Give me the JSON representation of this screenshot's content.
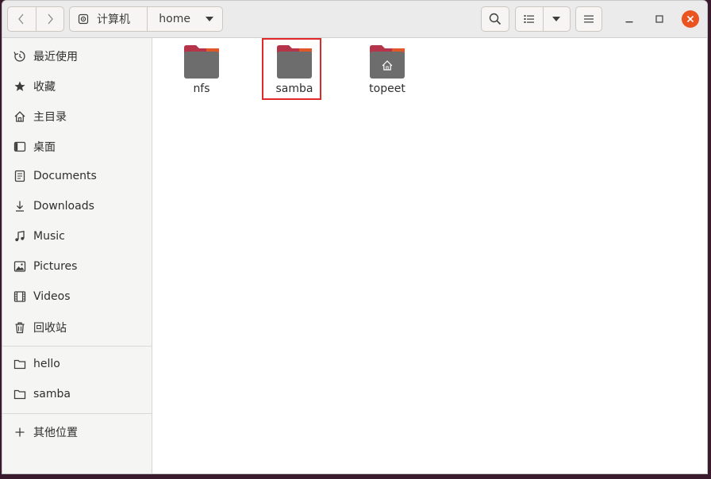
{
  "headerbar": {
    "path": [
      "计算机",
      "home"
    ],
    "icons": {
      "back": "chevron-left-icon",
      "forward": "chevron-right-icon",
      "drive": "drive-icon",
      "path_menu": "chevron-down-icon",
      "search": "search-icon",
      "list_view": "list-view-icon",
      "view_options": "chevron-down-icon",
      "main_menu": "hamburger-menu-icon"
    }
  },
  "window_controls": [
    "minimize",
    "maximize",
    "close"
  ],
  "sidebar": {
    "places": [
      {
        "label": "最近使用",
        "icon": "clock-icon"
      },
      {
        "label": "收藏",
        "icon": "star-icon"
      },
      {
        "label": "主目录",
        "icon": "home-icon"
      },
      {
        "label": "桌面",
        "icon": "desktop-icon"
      },
      {
        "label": "Documents",
        "icon": "document-icon"
      },
      {
        "label": "Downloads",
        "icon": "download-icon"
      },
      {
        "label": "Music",
        "icon": "music-icon"
      },
      {
        "label": "Pictures",
        "icon": "picture-icon"
      },
      {
        "label": "Videos",
        "icon": "video-icon"
      },
      {
        "label": "回收站",
        "icon": "trash-icon"
      }
    ],
    "bookmarks": [
      {
        "label": "hello",
        "icon": "folder-icon"
      },
      {
        "label": "samba",
        "icon": "folder-icon"
      }
    ],
    "other": {
      "label": "其他位置",
      "icon": "plus-icon"
    }
  },
  "files": [
    {
      "name": "nfs",
      "type": "folder"
    },
    {
      "name": "samba",
      "type": "folder",
      "highlighted": true
    },
    {
      "name": "topeet",
      "type": "home-folder"
    }
  ],
  "colors": {
    "accent": "#e95420",
    "highlight_box": "#e02828",
    "folder_body": "#6d6d6d",
    "folder_tab": "#b5344a"
  }
}
